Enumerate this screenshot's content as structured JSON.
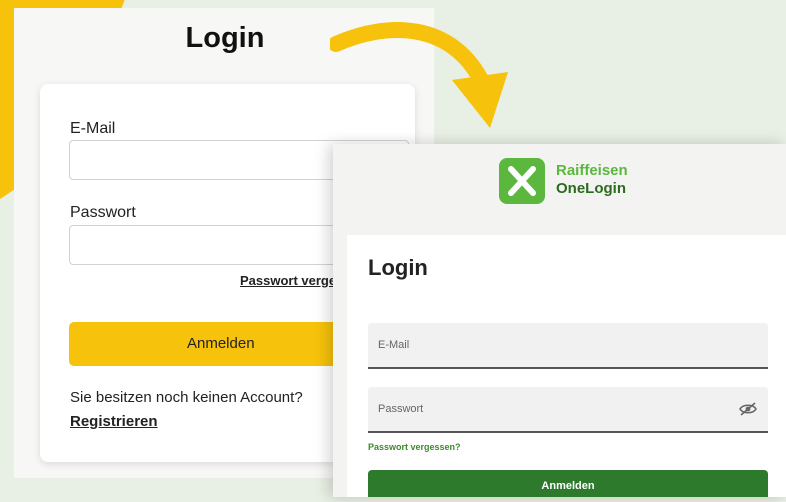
{
  "old_login": {
    "title": "Login",
    "email_label": "E-Mail",
    "password_label": "Passwort",
    "forgot_password": "Passwort vergessen?",
    "login_button": "Anmelden",
    "no_account_text": "Sie besitzen noch keinen Account?",
    "register_link": "Registrieren",
    "accent_color": "#f6c20b"
  },
  "new_login": {
    "brand_line1": "Raiffeisen",
    "brand_line2": "OneLogin",
    "title": "Login",
    "email_placeholder": "E-Mail",
    "password_placeholder": "Passwort",
    "password_toggle_icon": "eye-slash-icon",
    "forgot_password": "Passwort vergessen?",
    "login_button": "Anmelden",
    "brand_color": "#5cb73e",
    "button_color": "#2d7a2c"
  },
  "arrow_color": "#f6c20b"
}
